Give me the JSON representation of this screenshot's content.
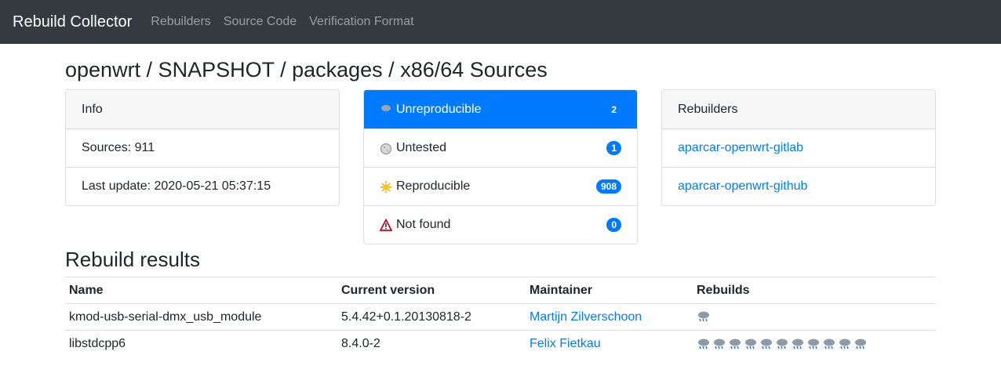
{
  "nav": {
    "brand": "Rebuild Collector",
    "links": [
      "Rebuilders",
      "Source Code",
      "Verification Format"
    ]
  },
  "page_title": "openwrt / SNAPSHOT / packages / x86/64 Sources",
  "info_card": {
    "header": "Info",
    "sources": "Sources: 911",
    "last_update": "Last update: 2020-05-21 05:37:15"
  },
  "status_card": {
    "items": [
      {
        "label": "Unreproducible",
        "count": "2",
        "icon": "storm-cloud-icon"
      },
      {
        "label": "Untested",
        "count": "1",
        "icon": "moon-icon"
      },
      {
        "label": "Reproducible",
        "count": "908",
        "icon": "sun-icon"
      },
      {
        "label": "Not found",
        "count": "0",
        "icon": "warning-icon"
      }
    ]
  },
  "rebuilders_card": {
    "header": "Rebuilders",
    "links": [
      "aparcar-openwrt-gitlab",
      "aparcar-openwrt-github"
    ]
  },
  "results": {
    "title": "Rebuild results",
    "columns": [
      "Name",
      "Current version",
      "Maintainer",
      "Rebuilds"
    ],
    "rows": [
      {
        "name": "kmod-usb-serial-dmx_usb_module",
        "version": "5.4.42+0.1.20130818-2",
        "maintainer": "Martijn Zilverschoon",
        "rebuilds": 1
      },
      {
        "name": "libstdcpp6",
        "version": "8.4.0-2",
        "maintainer": "Felix Fietkau",
        "rebuilds": 11
      }
    ]
  },
  "colors": {
    "accent": "#007bff",
    "navbar": "#343a40"
  }
}
